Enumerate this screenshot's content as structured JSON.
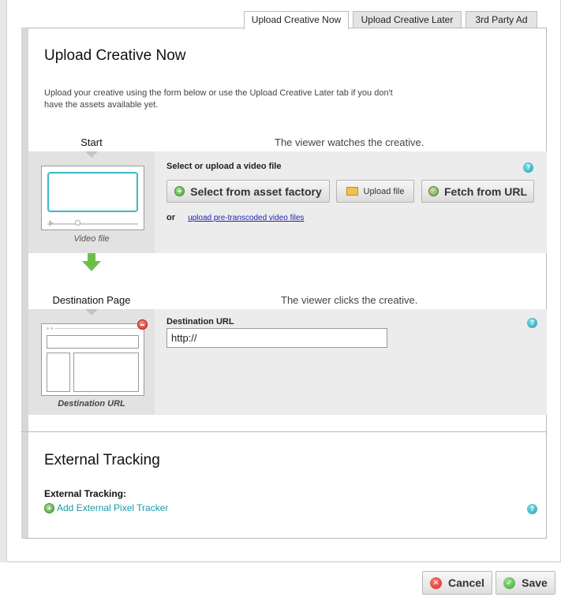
{
  "tabs": [
    {
      "label": "Upload Creative Now",
      "active": true
    },
    {
      "label": "Upload Creative Later",
      "active": false
    },
    {
      "label": "3rd Party Ad",
      "active": false
    }
  ],
  "upload_section": {
    "title": "Upload Creative Now",
    "intro": "Upload your creative using the form below or use the Upload Creative Later tab if you don't have the assets available yet."
  },
  "video_step": {
    "label": "Start",
    "description": "The viewer watches the creative.",
    "icon_caption": "Video file",
    "field_label": "Select or upload a video file",
    "buttons": {
      "asset_factory": "Select from asset factory",
      "upload_file": "Upload file",
      "fetch_url": "Fetch from URL"
    },
    "or_text": "or",
    "pretranscoded_link": "upload pre-transcoded video files"
  },
  "destination_step": {
    "label": "Destination Page",
    "description": "The viewer clicks the creative.",
    "icon_caption": "Destination URL",
    "field_label": "Destination URL",
    "url_value": "http://"
  },
  "tracking_section": {
    "title": "External Tracking",
    "label": "External Tracking:",
    "add_link": "Add External Pixel Tracker"
  },
  "footer": {
    "cancel_label": "Cancel",
    "save_label": "Save"
  },
  "colors": {
    "accent_link": "#1a9aa8",
    "step_arrow_green": "#6cc04a",
    "cancel_red": "#e0352b",
    "save_green": "#4ab24a"
  },
  "icons": [
    "plus-circle-icon",
    "folder-icon",
    "globe-icon",
    "help-icon",
    "remove-icon",
    "arrow-down-icon",
    "cancel-icon",
    "checkmark-icon"
  ]
}
